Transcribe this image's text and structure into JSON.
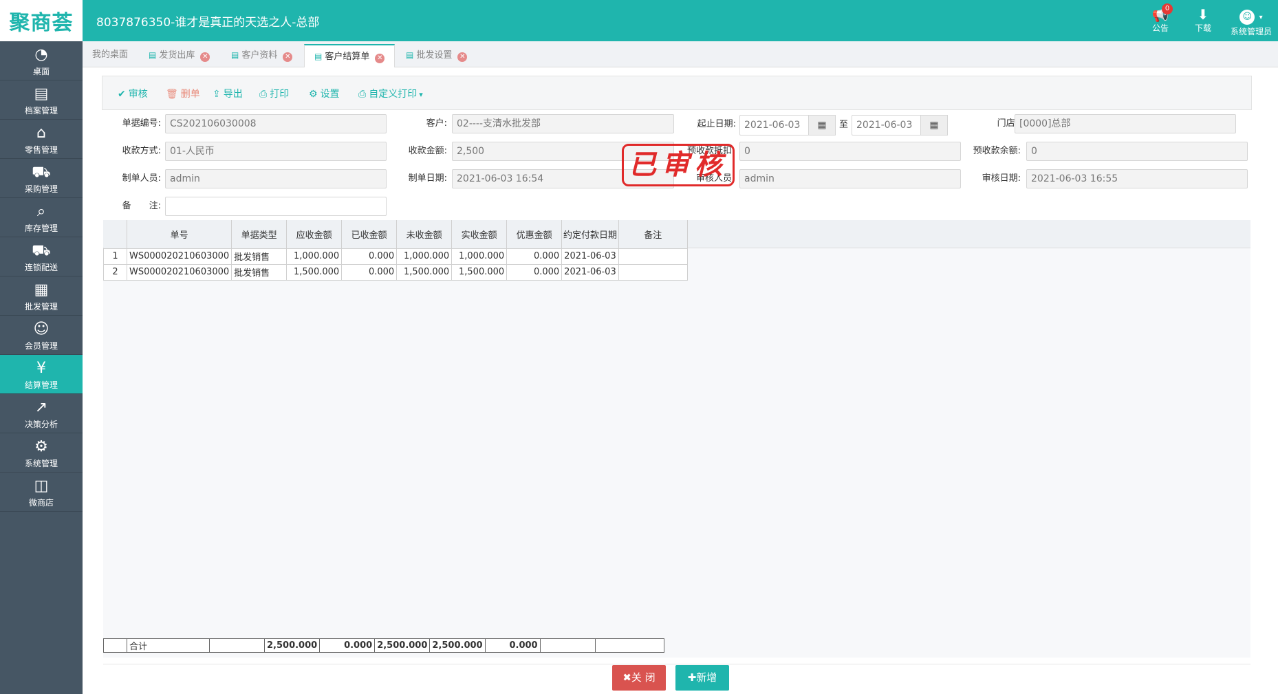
{
  "app": {
    "logo": "聚商荟",
    "title": "8037876350-谁才是真正的天选之人-总部"
  },
  "top_actions": [
    {
      "icon": "megaphone-icon",
      "glyph": "📢",
      "label": "公告",
      "badge": "0"
    },
    {
      "icon": "download-icon",
      "glyph": "⬇",
      "label": "下载"
    },
    {
      "icon": "avatar-icon",
      "glyph": "☺",
      "label": "系统管理员"
    }
  ],
  "sidebar": [
    {
      "label": "桌面",
      "glyph": "◔",
      "icon": "dashboard-icon"
    },
    {
      "label": "档案管理",
      "glyph": "▤",
      "icon": "file-icon"
    },
    {
      "label": "零售管理",
      "glyph": "⌂",
      "icon": "store-icon"
    },
    {
      "label": "采购管理",
      "glyph": "⛟",
      "icon": "cart-icon"
    },
    {
      "label": "库存管理",
      "glyph": "⌕",
      "icon": "inventory-icon"
    },
    {
      "label": "连锁配送",
      "glyph": "⛟",
      "icon": "truck-icon"
    },
    {
      "label": "批发管理",
      "glyph": "▦",
      "icon": "wholesale-icon"
    },
    {
      "label": "会员管理",
      "glyph": "☺",
      "icon": "member-icon"
    },
    {
      "label": "结算管理",
      "glyph": "¥",
      "icon": "settlement-icon",
      "active": true
    },
    {
      "label": "决策分析",
      "glyph": "↗",
      "icon": "chart-icon"
    },
    {
      "label": "系统管理",
      "glyph": "⚙",
      "icon": "gear-icon"
    },
    {
      "label": "微商店",
      "glyph": "◫",
      "icon": "bag-icon"
    }
  ],
  "tabs": [
    {
      "label": "我的桌面",
      "closable": false
    },
    {
      "label": "发货出库",
      "closable": true
    },
    {
      "label": "客户资料",
      "closable": true
    },
    {
      "label": "客户结算单",
      "closable": true,
      "active": true
    },
    {
      "label": "批发设置",
      "closable": true
    }
  ],
  "toolbar": {
    "approve": "审核",
    "delete": "删单",
    "export": "导出",
    "print": "打印",
    "settings": "设置",
    "custom_print": "自定义打印"
  },
  "form": {
    "doc_no_label": "单据编号:",
    "doc_no": "CS202106030008",
    "customer_label": "客户:",
    "customer": "02----支清水批发部",
    "date_range_label": "起止日期:",
    "date_from": "2021-06-03",
    "to_label": "至",
    "date_to": "2021-06-03",
    "store_label": "门店:",
    "store": "[0000]总部",
    "pay_method_label": "收款方式:",
    "pay_method": "01-人民币",
    "amount_label": "收款金额:",
    "amount": "2,500",
    "prepay_deduct_label": "预收款抵扣",
    "prepay_deduct": "0",
    "prepay_balance_label": "预收款余额:",
    "prepay_balance": "0",
    "creator_label": "制单人员:",
    "creator": "admin",
    "create_date_label": "制单日期:",
    "create_date": "2021-06-03 16:54",
    "auditor_label": "审核人员",
    "auditor": "admin",
    "audit_date_label": "审核日期:",
    "audit_date": "2021-06-03 16:55",
    "remark_label": "备　　注:",
    "remark": ""
  },
  "stamp": "已审核",
  "grid": {
    "columns": [
      "",
      "单号",
      "单据类型",
      "应收金额",
      "已收金额",
      "未收金额",
      "实收金额",
      "优惠金额",
      "约定付款日期",
      "备注"
    ],
    "rows": [
      [
        "1",
        "WS000020210603000",
        "批发销售",
        "1,000.000",
        "0.000",
        "1,000.000",
        "1,000.000",
        "0.000",
        "2021-06-03",
        ""
      ],
      [
        "2",
        "WS000020210603000",
        "批发销售",
        "1,500.000",
        "0.000",
        "1,500.000",
        "1,500.000",
        "0.000",
        "2021-06-03",
        ""
      ]
    ],
    "total": [
      "",
      "合计",
      "",
      "2,500.000",
      "0.000",
      "2,500.000",
      "2,500.000",
      "0.000",
      "",
      ""
    ]
  },
  "footer": {
    "close": "✖关 闭",
    "add": "✚新增"
  },
  "colors": {
    "accent": "#1fb5ad",
    "sidebar": "#465664",
    "danger": "#d9534f",
    "stamp": "#e02020"
  }
}
